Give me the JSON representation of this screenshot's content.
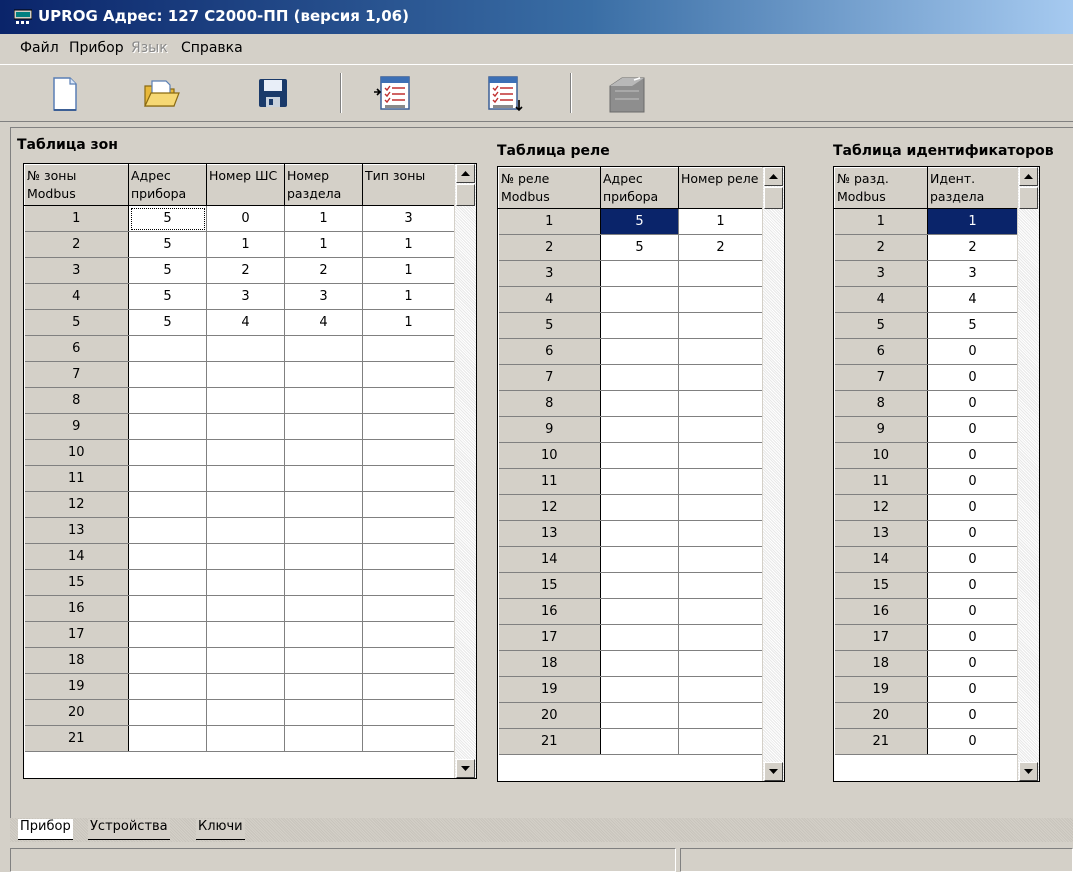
{
  "window": {
    "title": "UPROG  Адрес: 127  С2000-ПП (версия  1,06)"
  },
  "menu": [
    "Файл",
    "Прибор",
    "Язык",
    "Справка"
  ],
  "toolbar": [
    "new-file-icon",
    "open-folder-icon",
    "save-disk-icon",
    "read-from-device-icon",
    "write-to-device-icon",
    "device-icon"
  ],
  "zones": {
    "title": "Таблица зон",
    "headers": [
      "№ зоны Modbus",
      "Адрес прибора",
      "Номер ШС",
      "Номер раздела",
      "Тип зоны"
    ],
    "rows": [
      [
        "1",
        "5",
        "0",
        "1",
        "3"
      ],
      [
        "2",
        "5",
        "1",
        "1",
        "1"
      ],
      [
        "3",
        "5",
        "2",
        "2",
        "1"
      ],
      [
        "4",
        "5",
        "3",
        "3",
        "1"
      ],
      [
        "5",
        "5",
        "4",
        "4",
        "1"
      ],
      [
        "6",
        "",
        "",
        "",
        ""
      ],
      [
        "7",
        "",
        "",
        "",
        ""
      ],
      [
        "8",
        "",
        "",
        "",
        ""
      ],
      [
        "9",
        "",
        "",
        "",
        ""
      ],
      [
        "10",
        "",
        "",
        "",
        ""
      ],
      [
        "11",
        "",
        "",
        "",
        ""
      ],
      [
        "12",
        "",
        "",
        "",
        ""
      ],
      [
        "13",
        "",
        "",
        "",
        ""
      ],
      [
        "14",
        "",
        "",
        "",
        ""
      ],
      [
        "15",
        "",
        "",
        "",
        ""
      ],
      [
        "16",
        "",
        "",
        "",
        ""
      ],
      [
        "17",
        "",
        "",
        "",
        ""
      ],
      [
        "18",
        "",
        "",
        "",
        ""
      ],
      [
        "19",
        "",
        "",
        "",
        ""
      ],
      [
        "20",
        "",
        "",
        "",
        ""
      ],
      [
        "21",
        "",
        "",
        "",
        ""
      ]
    ]
  },
  "relays": {
    "title": "Таблица реле",
    "headers": [
      "№ реле Modbus",
      "Адрес прибора",
      "Номер реле"
    ],
    "rows": [
      [
        "1",
        "5",
        "1"
      ],
      [
        "2",
        "5",
        "2"
      ],
      [
        "3",
        "",
        ""
      ],
      [
        "4",
        "",
        ""
      ],
      [
        "5",
        "",
        ""
      ],
      [
        "6",
        "",
        ""
      ],
      [
        "7",
        "",
        ""
      ],
      [
        "8",
        "",
        ""
      ],
      [
        "9",
        "",
        ""
      ],
      [
        "10",
        "",
        ""
      ],
      [
        "11",
        "",
        ""
      ],
      [
        "12",
        "",
        ""
      ],
      [
        "13",
        "",
        ""
      ],
      [
        "14",
        "",
        ""
      ],
      [
        "15",
        "",
        ""
      ],
      [
        "16",
        "",
        ""
      ],
      [
        "17",
        "",
        ""
      ],
      [
        "18",
        "",
        ""
      ],
      [
        "19",
        "",
        ""
      ],
      [
        "20",
        "",
        ""
      ],
      [
        "21",
        "",
        ""
      ]
    ]
  },
  "idents": {
    "title": "Таблица идентификаторов",
    "headers": [
      "№ разд. Modbus",
      "Идент. раздела"
    ],
    "rows": [
      [
        "1",
        "1"
      ],
      [
        "2",
        "2"
      ],
      [
        "3",
        "3"
      ],
      [
        "4",
        "4"
      ],
      [
        "5",
        "5"
      ],
      [
        "6",
        "0"
      ],
      [
        "7",
        "0"
      ],
      [
        "8",
        "0"
      ],
      [
        "9",
        "0"
      ],
      [
        "10",
        "0"
      ],
      [
        "11",
        "0"
      ],
      [
        "12",
        "0"
      ],
      [
        "13",
        "0"
      ],
      [
        "14",
        "0"
      ],
      [
        "15",
        "0"
      ],
      [
        "16",
        "0"
      ],
      [
        "17",
        "0"
      ],
      [
        "18",
        "0"
      ],
      [
        "19",
        "0"
      ],
      [
        "20",
        "0"
      ],
      [
        "21",
        "0"
      ]
    ]
  },
  "tabs": [
    "Прибор",
    "Устройства",
    "Ключи"
  ],
  "colors": {
    "selection": "#0a246a",
    "face": "#d4d0c8",
    "title_start": "#0a246a",
    "title_end": "#a6caf0"
  }
}
